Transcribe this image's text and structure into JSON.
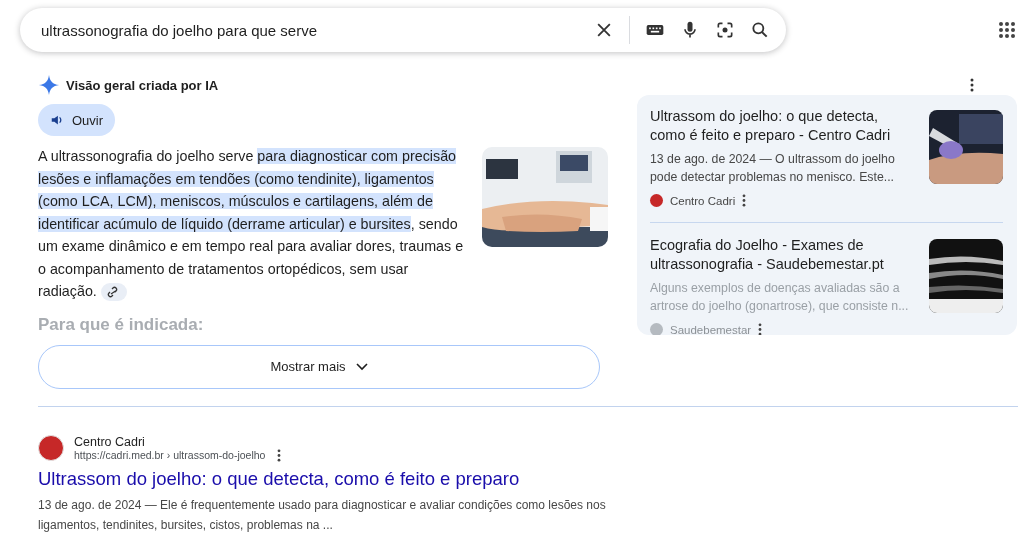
{
  "search": {
    "value": "ultrassonografia do joelho para que serve"
  },
  "ai_overview": {
    "title": "Visão geral criada por IA",
    "listen_button": "Ouvir",
    "paragraph": [
      {
        "text": "A ultrassonografia do joelho serve ",
        "highlighted": false
      },
      {
        "text": "para diagnosticar com precisão lesões e inflamações em tendões (como tendinite), ligamentos (como LCA, LCM), meniscos, músculos e cartilagens, além de identificar acúmulo de líquido (derrame articular) e bursites",
        "highlighted": true
      },
      {
        "text": ", sendo um exame dinâmico e em tempo real para avaliar dores, traumas e o acompanhamento de tratamentos ortopédicos, sem usar radiação.",
        "highlighted": false
      }
    ],
    "faded_heading": "Para que é indicada:",
    "show_more_button": "Mostrar mais",
    "sources": [
      {
        "title": "Ultrassom do joelho: o que detecta, como é feito e preparo - Centro Cadri",
        "snippet": "13 de ago. de 2024 — O ultrassom do joelho pode detectar problemas no menisco. Este...",
        "site": "Centro Cadri",
        "faded": false
      },
      {
        "title": "Ecografia do Joelho - Exames de ultrassonografia - Saudebemestar.pt",
        "snippet": "Alguns exemplos de doenças avaliadas são a artrose do joelho (gonartrose), que consiste n...",
        "site": "Saudebemestar",
        "faded": true
      }
    ]
  },
  "result": {
    "site": "Centro Cadri",
    "url": "https://cadri.med.br › ultrassom-do-joelho",
    "title": "Ultrassom do joelho: o que detecta, como é feito e preparo",
    "snippet": "13 de ago. de 2024 — Ele é frequentemente usado para diagnosticar e avaliar condições como lesões nos ligamentos, tendinites, bursites, cistos, problemas na ..."
  }
}
